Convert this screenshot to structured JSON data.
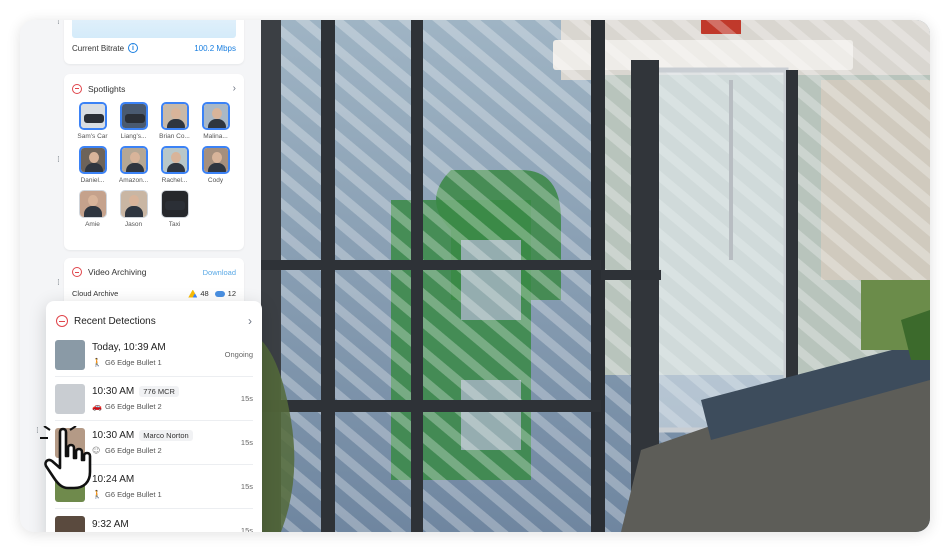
{
  "bitrate": {
    "label": "Current Bitrate",
    "value": "100.2 Mbps"
  },
  "spotlights": {
    "title": "Spotlights",
    "items": [
      {
        "label": "Sam's Car",
        "icon": "car-plate-thumb",
        "selected": true
      },
      {
        "label": "Liang's...",
        "icon": "car-thumb",
        "selected": true
      },
      {
        "label": "Brian Co...",
        "icon": "person-thumb",
        "selected": true
      },
      {
        "label": "Malina...",
        "icon": "person-thumb",
        "selected": true
      },
      {
        "label": "Daniel...",
        "icon": "person-thumb",
        "selected": true
      },
      {
        "label": "Amazon...",
        "icon": "person-thumb",
        "selected": true
      },
      {
        "label": "Rachel...",
        "icon": "person-thumb",
        "selected": true
      },
      {
        "label": "Cody",
        "icon": "person-thumb",
        "selected": true
      },
      {
        "label": "Amie",
        "icon": "person-thumb",
        "selected": false
      },
      {
        "label": "Jason",
        "icon": "person-thumb",
        "selected": false
      },
      {
        "label": "Taxi",
        "icon": "car-thumb",
        "selected": false
      }
    ]
  },
  "archiving": {
    "title": "Video Archiving",
    "download_label": "Download",
    "cloud_label": "Cloud Archive",
    "drive_count": "48",
    "cloud_count": "12"
  },
  "detections": {
    "title": "Recent Detections",
    "rows": [
      {
        "time": "Today, 10:39 AM",
        "tag": "",
        "camera": "G6 Edge Bullet 1",
        "status": "Ongoing",
        "type_icon": "person-icon",
        "thumb_color": "#8a9aa6"
      },
      {
        "time": "10:30 AM",
        "tag": "776 MCR",
        "camera": "G6 Edge Bullet 2",
        "status": "15s",
        "type_icon": "vehicle-icon",
        "thumb_color": "#c9cdd2"
      },
      {
        "time": "10:30 AM",
        "tag": "Marco Norton",
        "camera": "G6 Edge Bullet 2",
        "status": "15s",
        "type_icon": "face-icon",
        "thumb_color": "#b49a86"
      },
      {
        "time": "10:24 AM",
        "tag": "",
        "camera": "G6 Edge Bullet 1",
        "status": "15s",
        "type_icon": "person-icon",
        "thumb_color": "#6f8a4c"
      },
      {
        "time": "9:32 AM",
        "tag": "",
        "camera": "",
        "status": "15s",
        "type_icon": "person-icon",
        "thumb_color": "#5a4a3e"
      }
    ]
  }
}
